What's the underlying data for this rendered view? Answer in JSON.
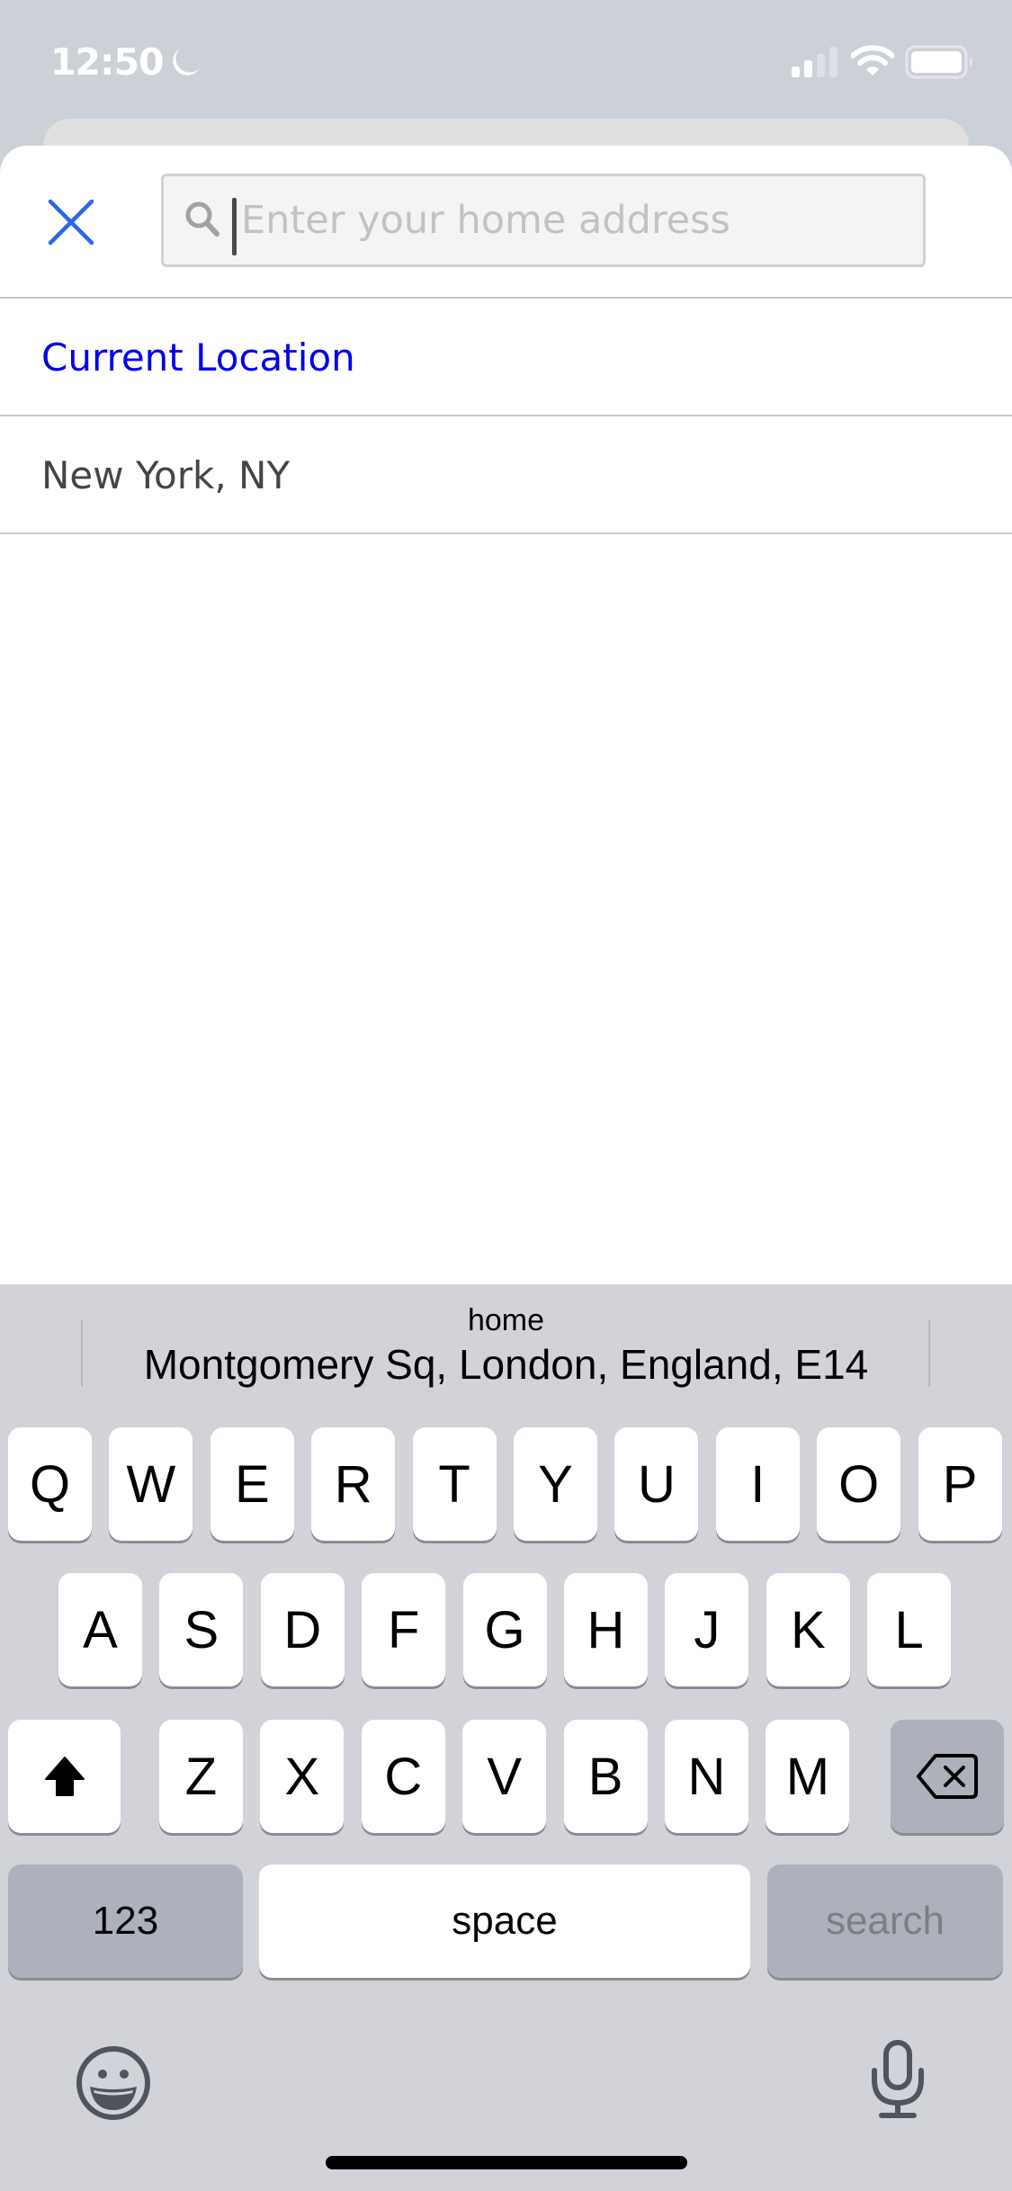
{
  "status_bar": {
    "time": "12:50",
    "focus_icon": "moon-icon",
    "signal_icon": "cellular-signal-icon",
    "wifi_icon": "wifi-icon",
    "battery_icon": "battery-icon"
  },
  "search_sheet": {
    "close_icon": "close-icon",
    "search_icon": "search-icon",
    "input_value": "",
    "input_placeholder": "Enter your home address"
  },
  "results": [
    {
      "label": "Current Location",
      "color": "#0000ee"
    },
    {
      "label": "New York, NY",
      "color": "#454545"
    }
  ],
  "keyboard": {
    "suggestion": {
      "label": "home",
      "value": "Montgomery Sq, London, England, E14"
    },
    "row1": [
      "Q",
      "W",
      "E",
      "R",
      "T",
      "Y",
      "U",
      "I",
      "O",
      "P"
    ],
    "row2": [
      "A",
      "S",
      "D",
      "F",
      "G",
      "H",
      "J",
      "K",
      "L"
    ],
    "row3": [
      "Z",
      "X",
      "C",
      "V",
      "B",
      "N",
      "M"
    ],
    "shift_icon": "shift-icon",
    "delete_icon": "delete-icon",
    "numbers_label": "123",
    "space_label": "space",
    "return_label": "search",
    "emoji_icon": "emoji-icon",
    "mic_icon": "microphone-icon"
  },
  "colors": {
    "accent": "#2563eb",
    "link": "#0000ee",
    "keyboard_bg": "#d2d3d8",
    "special_key": "#adb1bb"
  }
}
